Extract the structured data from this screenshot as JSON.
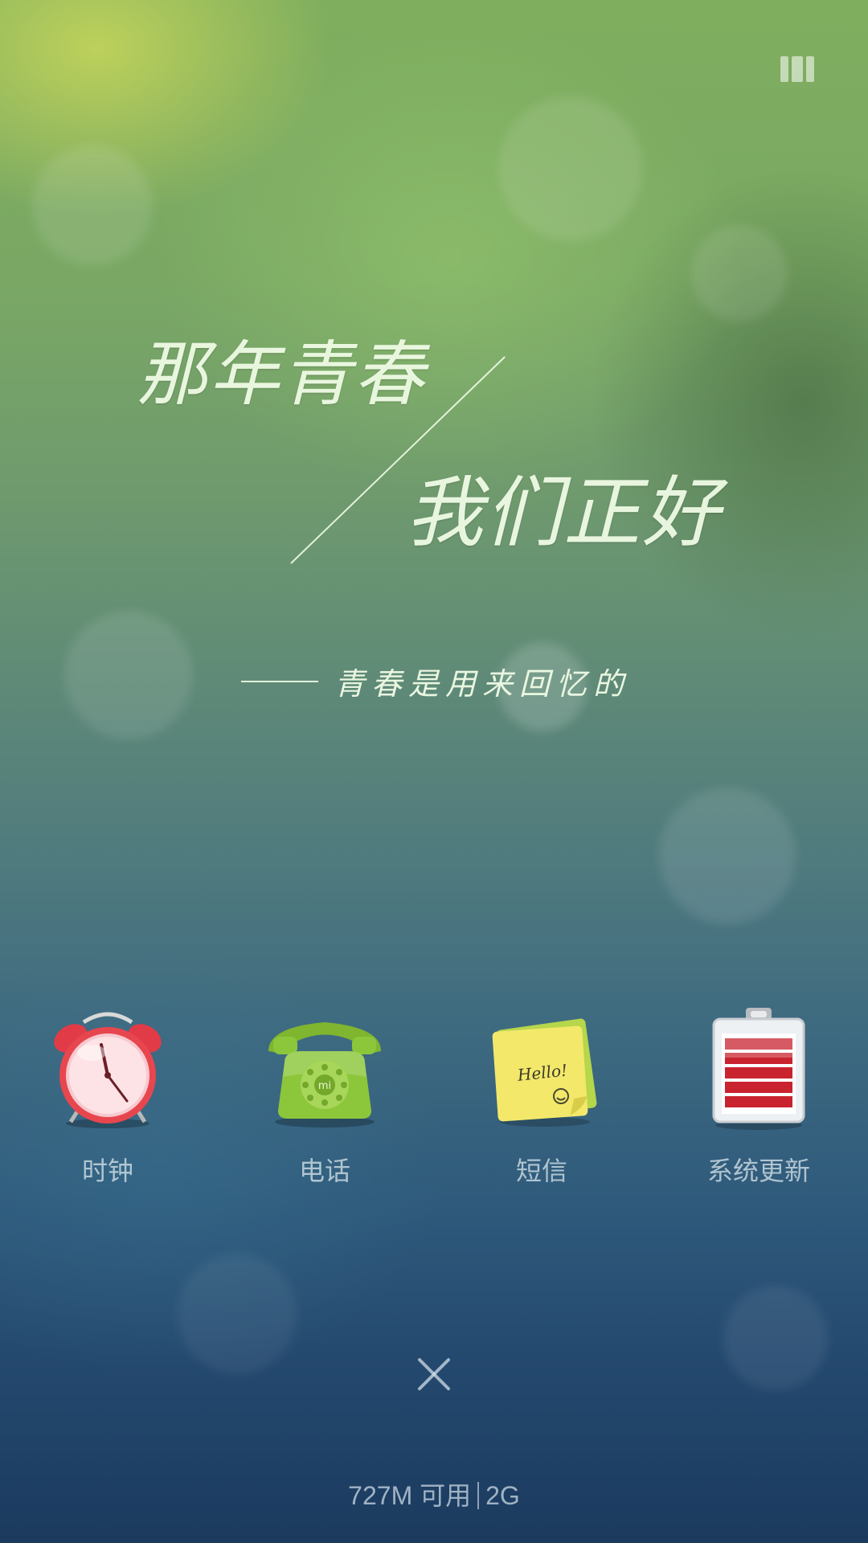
{
  "wallpaper": {
    "headline_line1": "那年青春",
    "headline_line2": "我们正好",
    "subline": "青春是用来回忆的"
  },
  "top_right_icon": "recent-apps-icon",
  "apps": [
    {
      "label": "时钟",
      "icon": "alarm-clock-icon"
    },
    {
      "label": "电话",
      "icon": "telephone-icon"
    },
    {
      "label": "短信",
      "icon": "sticky-note-icon"
    },
    {
      "label": "系统更新",
      "icon": "battery-update-icon"
    }
  ],
  "sms_icon_text": "Hello!",
  "phone_icon_text": "mi",
  "close_icon": "close-icon",
  "memory": {
    "available": "727M 可用",
    "total": "2G"
  },
  "colors": {
    "clock_red": "#e8464e",
    "phone_green": "#8cc63a",
    "note_yellow": "#f3e86a",
    "battery_red": "#c9232f"
  }
}
